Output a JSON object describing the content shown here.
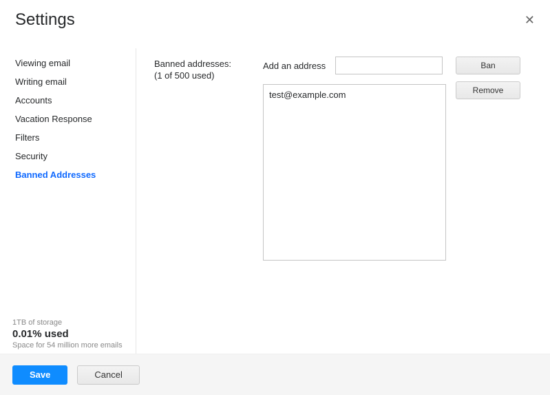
{
  "header": {
    "title": "Settings"
  },
  "sidebar": {
    "items": [
      {
        "label": "Viewing email"
      },
      {
        "label": "Writing email"
      },
      {
        "label": "Accounts"
      },
      {
        "label": "Vacation Response"
      },
      {
        "label": "Filters"
      },
      {
        "label": "Security"
      },
      {
        "label": "Banned Addresses"
      }
    ],
    "storage": {
      "total": "1TB of storage",
      "percent": "0.01% used",
      "detail": "Space for 54 million more emails"
    }
  },
  "main": {
    "banned_header": "Banned addresses:",
    "banned_count": "(1 of 500 used)",
    "add_label": "Add an address",
    "add_value": "",
    "ban_button": "Ban",
    "remove_button": "Remove",
    "list": [
      "test@example.com"
    ]
  },
  "footer": {
    "save": "Save",
    "cancel": "Cancel"
  }
}
